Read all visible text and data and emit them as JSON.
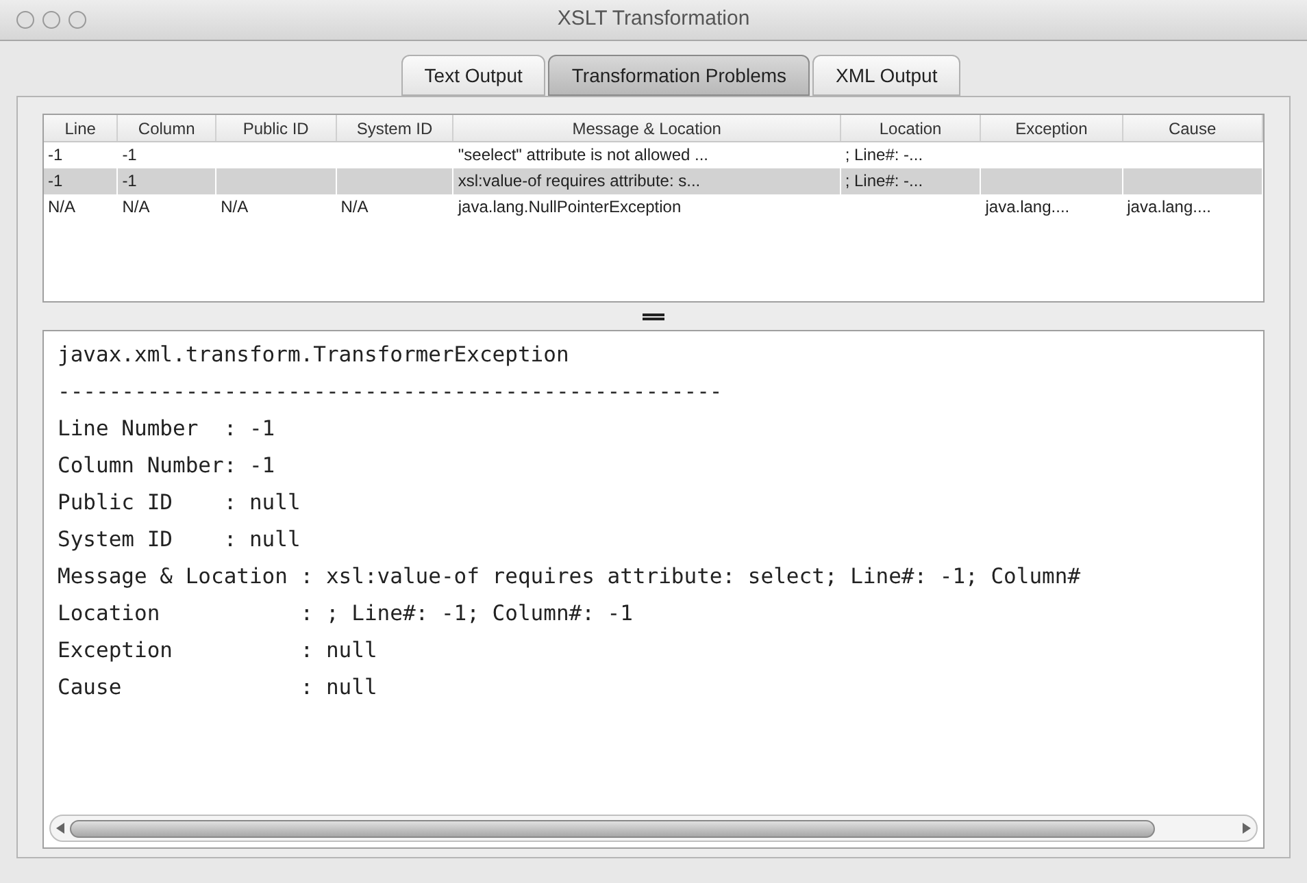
{
  "window": {
    "title": "XSLT Transformation"
  },
  "tabs": [
    {
      "label": "Text Output",
      "selected": false
    },
    {
      "label": "Transformation Problems",
      "selected": true
    },
    {
      "label": "XML Output",
      "selected": false
    }
  ],
  "table": {
    "columns": [
      "Line",
      "Column",
      "Public ID",
      "System ID",
      "Message & Location",
      "Location",
      "Exception",
      "Cause"
    ],
    "rows": [
      {
        "selected": false,
        "cells": [
          "-1",
          "-1",
          "",
          "",
          "\"seelect\" attribute is not allowed ...",
          "; Line#: -...",
          "",
          ""
        ]
      },
      {
        "selected": true,
        "cells": [
          "-1",
          "-1",
          "",
          "",
          "xsl:value-of requires attribute: s...",
          "; Line#: -...",
          "",
          ""
        ]
      },
      {
        "selected": false,
        "cells": [
          "N/A",
          "N/A",
          "N/A",
          "N/A",
          "java.lang.NullPointerException",
          "",
          "java.lang....",
          "java.lang...."
        ]
      }
    ]
  },
  "detail": {
    "lines": [
      "javax.xml.transform.TransformerException",
      "----------------------------------------------------",
      "Line Number  : -1",
      "Column Number: -1",
      "Public ID    : null",
      "System ID    : null",
      "Message & Location : xsl:value-of requires attribute: select; Line#: -1; Column#",
      "Location           : ; Line#: -1; Column#: -1",
      "Exception          : null",
      "Cause              : null"
    ]
  }
}
